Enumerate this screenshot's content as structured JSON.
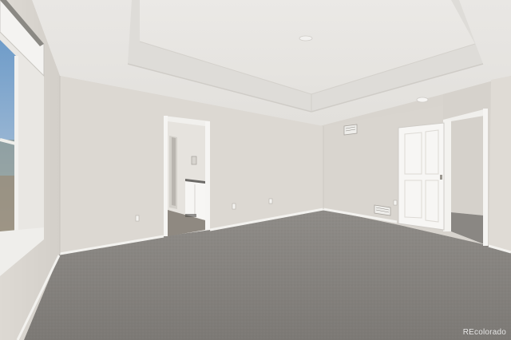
{
  "watermark": {
    "text": "REcolorado"
  }
}
